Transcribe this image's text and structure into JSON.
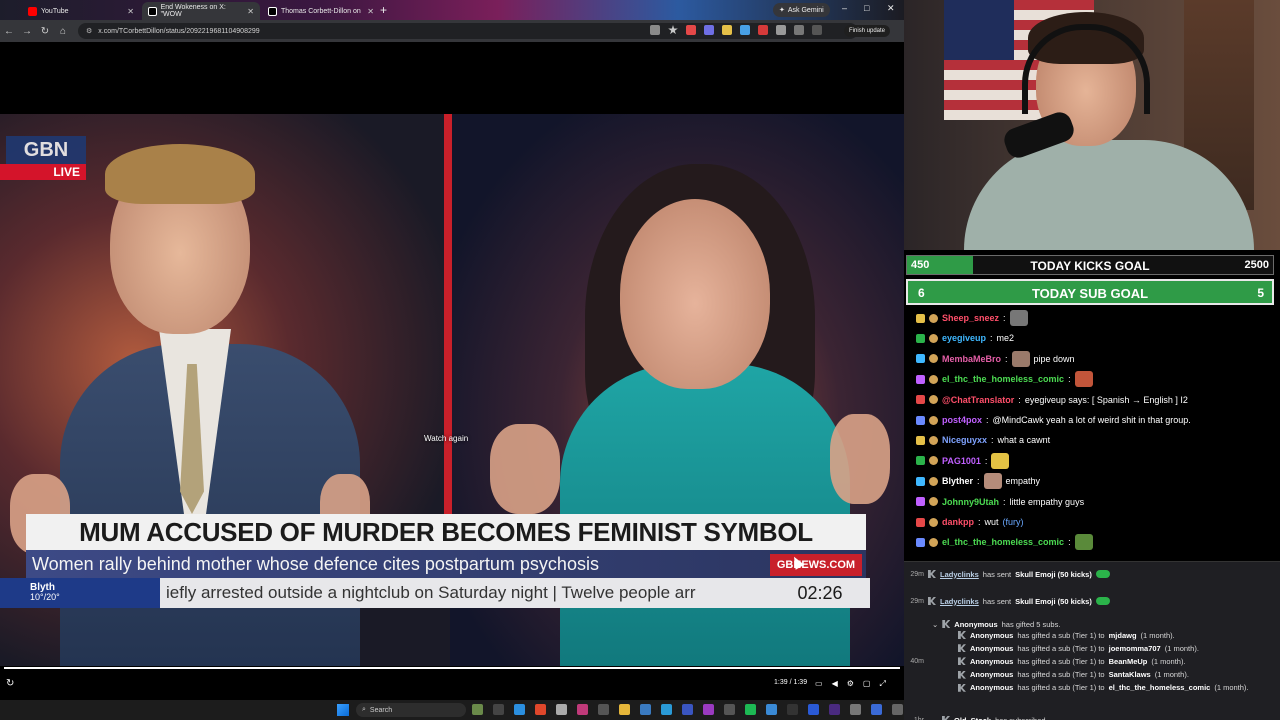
{
  "browser": {
    "tabs": [
      {
        "title": "YouTube",
        "color": "#ff0000"
      },
      {
        "title": "End Wokeness on X: \"WOW",
        "color": "#000000"
      },
      {
        "title": "Thomas Corbett-Dillon on",
        "color": "#000000"
      }
    ],
    "new_tab": "+",
    "ask_gemini": "Ask Gemini",
    "url": "x.com/TCorbettDillon/status/2092219681104908299",
    "finish_update": "Finish update",
    "window_controls": [
      "–",
      "□",
      "✕"
    ]
  },
  "video": {
    "channel_logo": "GBN",
    "live_badge": "LIVE",
    "headline": "MUM ACCUSED OF MURDER BECOMES FEMINIST SYMBOL",
    "subheadline": "Women rally behind mother whose defence cites postpartum psychosis",
    "brand": "GBNEWS.COM",
    "weather_place": "Blyth",
    "weather_temp": "10°/20°",
    "ticker": "iefly arrested outside a nightclub on Saturday night  |  Twelve people arr",
    "clock": "02:26",
    "watch_again": "Watch again",
    "timecode": "1:39 / 1:39",
    "progress": 1.0
  },
  "taskbar": {
    "search_label": "Search"
  },
  "goals": {
    "kicks": {
      "start": "450",
      "label": "TODAY KICKS GOAL",
      "end": "2500",
      "progress": 0.18
    },
    "subs": {
      "start": "6",
      "label": "TODAY SUB GOAL",
      "end": "5"
    }
  },
  "chat": [
    {
      "user": "Sheep_sneez",
      "color": "#ff4f6a",
      "sep": ":",
      "text": "",
      "emote": "#777777"
    },
    {
      "user": "eyegiveup",
      "color": "#3fb8ff",
      "sep": ":",
      "text": "me2"
    },
    {
      "user": "MembaMeBro",
      "color": "#e55fa8",
      "sep": ":",
      "text": "pipe down",
      "emote": "#9a7a6a"
    },
    {
      "user": "el_thc_the_homeless_comic",
      "color": "#4cdb52",
      "sep": ":",
      "text": "",
      "emote": "#c2553a"
    },
    {
      "user": "@ChatTranslator",
      "color": "#ff4f6a",
      "sep": ":",
      "text": "eyegiveup says: [ Spanish → English ] I2"
    },
    {
      "user": "post4pox",
      "color": "#c060ff",
      "sep": ":",
      "text": "@MindCawk yeah a lot of weird shit in that group."
    },
    {
      "user": "Niceguyxx",
      "color": "#7fa3ff",
      "sep": ":",
      "text": "what a cawnt"
    },
    {
      "user": "PAG1001",
      "color": "#c060ff",
      "sep": ":",
      "text": "",
      "emote": "#e3c244"
    },
    {
      "user": "Blyther",
      "color": "#ffffff",
      "sep": ":",
      "text": "empathy",
      "emote": "#b58c7a"
    },
    {
      "user": "Johnny9Utah",
      "color": "#4cdb52",
      "sep": ":",
      "text": "little empathy guys"
    },
    {
      "user": "dankpp",
      "color": "#ff4f6a",
      "sep": ":",
      "text": "wut",
      "extra": "(fury)",
      "extra_color": "#6aa8ff"
    },
    {
      "user": "el_thc_the_homeless_comic",
      "color": "#4cdb52",
      "sep": ":",
      "text": "",
      "emote": "#5a8a3a"
    }
  ],
  "events": [
    {
      "time": "29m",
      "name": "Ladyclinks",
      "text": "has sent",
      "bold": "Skull Emoji (50 kicks)"
    },
    {
      "time": "29m",
      "name": "Ladyclinks",
      "text": "has sent",
      "bold": "Skull Emoji (50 kicks)"
    }
  ],
  "gift_header": {
    "name": "Anonymous",
    "text": "has gifted 5 subs."
  },
  "gift_time": "40m",
  "gifts": [
    {
      "name": "Anonymous",
      "text": "has gifted a sub (Tier 1) to",
      "to": "mjdawg",
      "dur": "(1 month)."
    },
    {
      "name": "Anonymous",
      "text": "has gifted a sub (Tier 1) to",
      "to": "joemomma707",
      "dur": "(1 month)."
    },
    {
      "name": "Anonymous",
      "text": "has gifted a sub (Tier 1) to",
      "to": "BeanMeUp",
      "dur": "(1 month)."
    },
    {
      "name": "Anonymous",
      "text": "has gifted a sub (Tier 1) to",
      "to": "SantaKlaws",
      "dur": "(1 month)."
    },
    {
      "name": "Anonymous",
      "text": "has gifted a sub (Tier 1) to",
      "to": "el_thc_the_homeless_comic",
      "dur": "(1 month)."
    }
  ],
  "last_event": {
    "time": "1hr",
    "name": "Old_Stock",
    "text": "has subscribed"
  }
}
